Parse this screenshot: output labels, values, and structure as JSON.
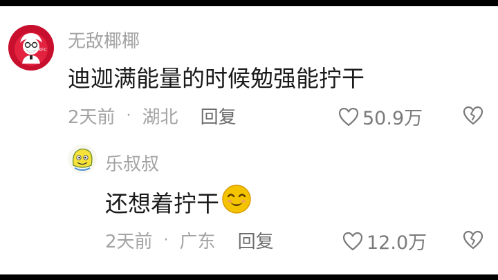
{
  "comments": [
    {
      "username": "无敌椰椰",
      "text": "迪迦满能量的时候勉强能拧干",
      "time": "2天前",
      "location": "湖北",
      "reply_label": "回复",
      "likes": "50.9万",
      "avatar_icon": "kfc-colonel-avatar-icon"
    },
    {
      "username": "乐叔叔",
      "text": "还想着拧干",
      "time": "2天前",
      "location": "广东",
      "reply_label": "回复",
      "likes": "12.0万",
      "avatar_icon": "cartoon-character-avatar-icon",
      "emoji": "smiling-face-emoji"
    }
  ],
  "separator": "·",
  "colors": {
    "username": "#a3a3a3",
    "text": "#1a1a1a",
    "meta": "#a3a3a3",
    "reply": "#6e6e6e",
    "kfc_red": "#c8102e",
    "emoji_yellow": "#f5c400"
  }
}
